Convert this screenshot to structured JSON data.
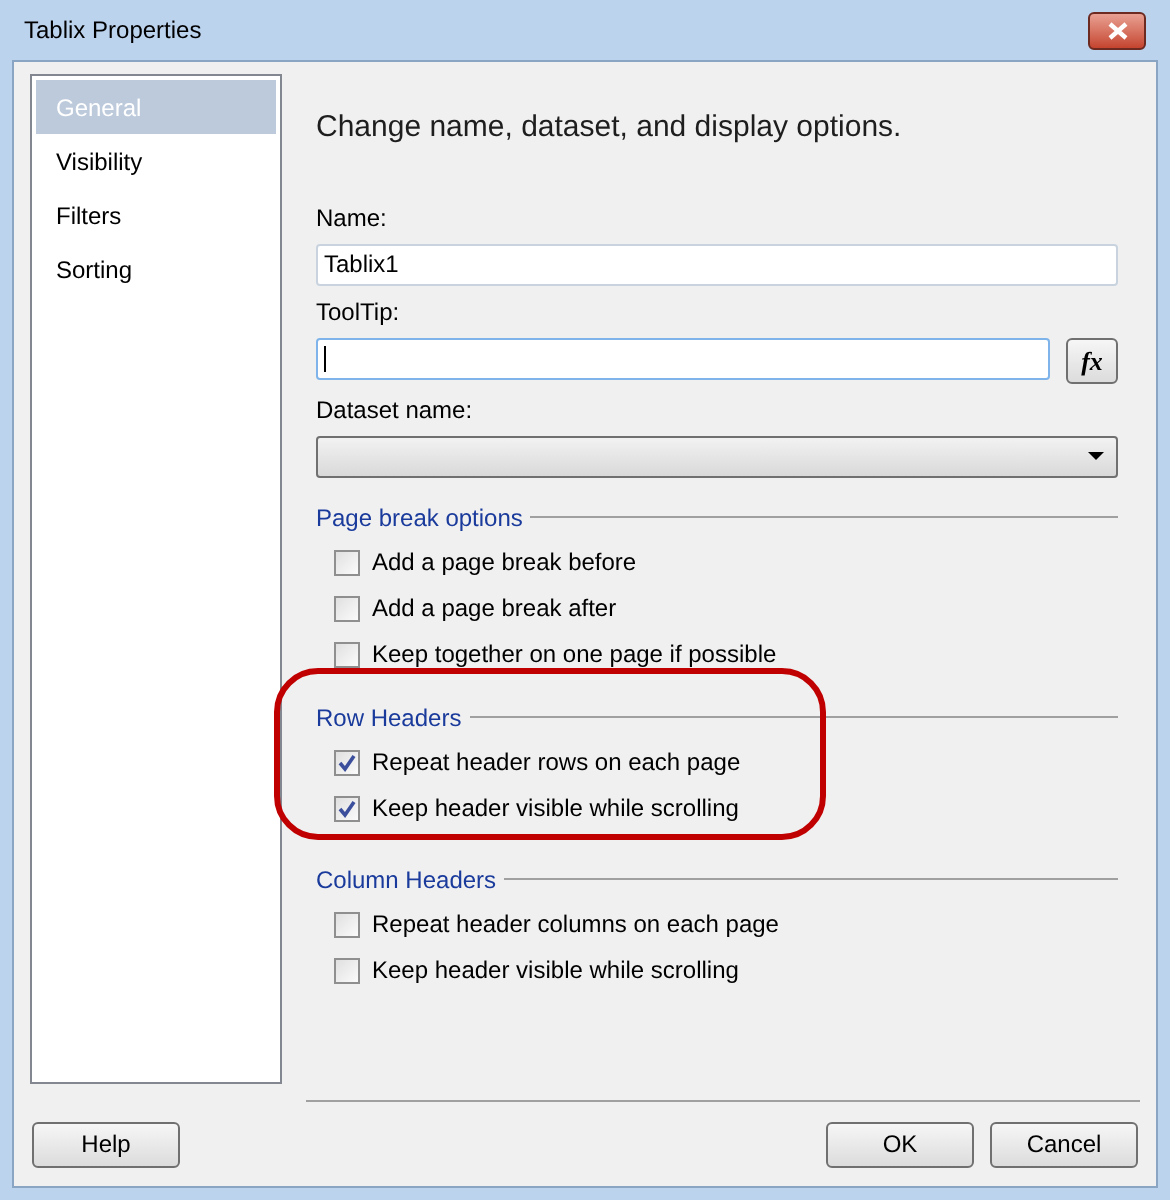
{
  "window": {
    "title": "Tablix Properties"
  },
  "sidebar": {
    "items": [
      {
        "label": "General",
        "selected": true
      },
      {
        "label": "Visibility",
        "selected": false
      },
      {
        "label": "Filters",
        "selected": false
      },
      {
        "label": "Sorting",
        "selected": false
      }
    ]
  },
  "heading": "Change name, dataset, and display options.",
  "name_field": {
    "label": "Name:",
    "value": "Tablix1"
  },
  "tooltip_field": {
    "label": "ToolTip:",
    "expression_button": "fx"
  },
  "dataset_field": {
    "label": "Dataset name:"
  },
  "sections": [
    {
      "title": "Page break options",
      "highlighted": false,
      "options": [
        {
          "label": "Add a page break before",
          "checked": false
        },
        {
          "label": "Add a page break after",
          "checked": false
        },
        {
          "label": "Keep together on one page if possible",
          "checked": false
        }
      ]
    },
    {
      "title": "Row Headers",
      "highlighted": true,
      "options": [
        {
          "label": "Repeat header rows on each page",
          "checked": true
        },
        {
          "label": "Keep header visible while scrolling",
          "checked": true
        }
      ]
    },
    {
      "title": "Column Headers",
      "highlighted": false,
      "options": [
        {
          "label": "Repeat header columns on each page",
          "checked": false
        },
        {
          "label": "Keep header visible while scrolling",
          "checked": false
        }
      ]
    }
  ],
  "buttons": {
    "help": "Help",
    "ok": "OK",
    "cancel": "Cancel"
  }
}
